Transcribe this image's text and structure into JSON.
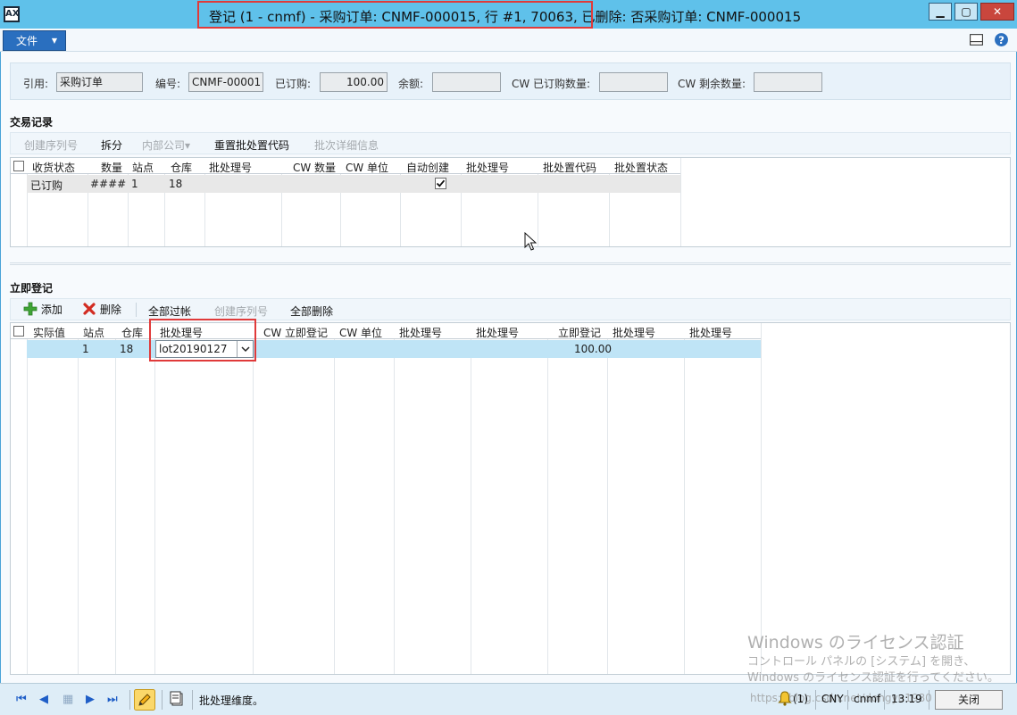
{
  "window": {
    "title": "登记 (1 - cnmf) - 采购订单: CNMF-000015, 行 #1, 70063, 已删除: 否采购订单: CNMF-000015",
    "app_icon_text": "AX",
    "min_glyph": "▁",
    "max_glyph": "▢",
    "close_glyph": "✕"
  },
  "menu": {
    "file_label": "文件",
    "file_caret": "▼"
  },
  "reference": {
    "ref_label": "引用:",
    "ref_value": "采购订单",
    "number_label": "编号:",
    "number_value": "CNMF-00001",
    "ordered_label": "已订购:",
    "ordered_value": "100.00",
    "balance_label": "余额:",
    "balance_value": "",
    "cw_ordered_label": "CW 已订购数量:",
    "cw_ordered_value": "",
    "cw_remaining_label": "CW 剩余数量:",
    "cw_remaining_value": ""
  },
  "transactions": {
    "title": "交易记录",
    "toolbar": {
      "create_serial": "创建序列号",
      "split": "拆分",
      "intercompany": "内部公司▾",
      "reset_disposition": "重置批处置代码",
      "batch_details": "批次详细信息"
    },
    "columns": [
      "收货状态",
      "数量",
      "站点",
      "仓库",
      "批处理号",
      "CW 数量",
      "CW 单位",
      "自动创建",
      "批处理号",
      "批处置代码",
      "批处置状态"
    ],
    "rows": [
      {
        "status": "已订购",
        "qty": "####",
        "site": "1",
        "warehouse": "18",
        "batch": "",
        "cw_qty": "",
        "cw_unit": "",
        "auto_create": true,
        "batch2": "",
        "disposition_code": "",
        "disposition_status": ""
      }
    ]
  },
  "registration": {
    "title": "立即登记",
    "toolbar": {
      "add": "添加",
      "delete": "删除",
      "post_all": "全部过帐",
      "create_serial": "创建序列号",
      "delete_all": "全部删除"
    },
    "columns": [
      "实际值",
      "站点",
      "仓库",
      "批处理号",
      "CW 立即登记",
      "CW 单位",
      "批处理号",
      "批处理号",
      "立即登记",
      "批处理号",
      "批处理号"
    ],
    "rows": [
      {
        "actual": "",
        "site": "1",
        "warehouse": "18",
        "batch": "lot20190127",
        "cw_register": "",
        "cw_unit": "",
        "batch2": "",
        "batch3": "",
        "register_now": "100.00",
        "batch4": "",
        "batch5": ""
      }
    ]
  },
  "statusbar": {
    "nav_first": "⏮",
    "nav_prev": "◀",
    "nav_grid": "▦",
    "nav_next": "▶",
    "nav_last": "⏭",
    "text": "批处理维度。",
    "notif": "(1)",
    "currency": "CNY",
    "company": "cnmf",
    "time": "13:19",
    "close_label": "关闭"
  },
  "watermark": {
    "line1": "Windows のライセンス認証",
    "line2": "コントロール パネルの [システム] を開き、",
    "line3": "Windows のライセンス認証を行ってください。",
    "url": "https://blog.csdn.net/dongyu1980"
  }
}
